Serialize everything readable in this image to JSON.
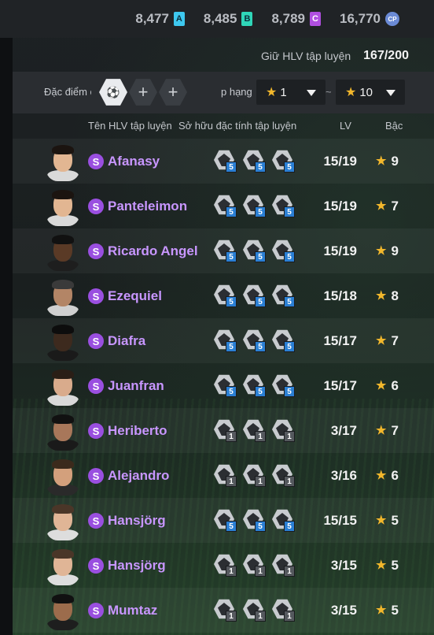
{
  "currency": [
    {
      "value": "8,477",
      "badge": "A",
      "color": "#3ec8ef"
    },
    {
      "value": "8,485",
      "badge": "B",
      "color": "#2fd6b8"
    },
    {
      "value": "8,789",
      "badge": "C",
      "color": "#b04fe0"
    },
    {
      "value": "16,770",
      "badge": "CP",
      "color": "#6b8bd6"
    }
  ],
  "coach_count": {
    "label": "Giữ HLV tập luyện",
    "value": "167/200"
  },
  "filter": {
    "trait_label": "Đặc điểm c",
    "rank_label": "p hạng",
    "min_rank": "1",
    "max_rank": "10",
    "tilde": "~",
    "add_symbol": "+"
  },
  "columns": {
    "name": "Tên HLV tập luyện",
    "traits": "Sở hữu đặc tính tập luyện",
    "lv": "LV",
    "bac": "Bậc"
  },
  "coaches": [
    {
      "grade": "S",
      "name": "Afanasy",
      "lv": "15/19",
      "bac": "9",
      "skin": "#e2b692",
      "hair": "#1b1410",
      "shirt": "#d9d9d9",
      "traits": [
        "5",
        "5",
        "5"
      ]
    },
    {
      "grade": "S",
      "name": "Panteleimon",
      "lv": "15/19",
      "bac": "7",
      "skin": "#e2b692",
      "hair": "#1b1410",
      "shirt": "#d9d9d9",
      "traits": [
        "5",
        "5",
        "5"
      ]
    },
    {
      "grade": "S",
      "name": "Ricardo Angel",
      "lv": "15/19",
      "bac": "9",
      "skin": "#5a3a26",
      "hair": "#111111",
      "shirt": "#1e1e1e",
      "traits": [
        "5",
        "5",
        "5"
      ]
    },
    {
      "grade": "S",
      "name": "Ezequiel",
      "lv": "15/18",
      "bac": "8",
      "skin": "#b38566",
      "hair": "#3a3a3a",
      "shirt": "#d0d0d0",
      "traits": [
        "5",
        "5",
        "5"
      ]
    },
    {
      "grade": "S",
      "name": "Diafra",
      "lv": "15/17",
      "bac": "7",
      "skin": "#3d2a1e",
      "hair": "#0d0d0d",
      "shirt": "#1a1a1a",
      "traits": [
        "5",
        "5",
        "5"
      ]
    },
    {
      "grade": "S",
      "name": "Juanfran",
      "lv": "15/17",
      "bac": "6",
      "skin": "#d9ab8c",
      "hair": "#2a1e16",
      "shirt": "#d9d9d9",
      "traits": [
        "5",
        "5",
        "5"
      ]
    },
    {
      "grade": "S",
      "name": "Heriberto",
      "lv": "3/17",
      "bac": "7",
      "skin": "#a8775a",
      "hair": "#111111",
      "shirt": "#1a1a1a",
      "traits": [
        "1",
        "1",
        "1"
      ]
    },
    {
      "grade": "S",
      "name": "Alejandro",
      "lv": "3/16",
      "bac": "6",
      "skin": "#d3a07c",
      "hair": "#3b2a1c",
      "shirt": "#2a2a2a",
      "traits": [
        "1",
        "1",
        "1"
      ]
    },
    {
      "grade": "S",
      "name": "Hansjörg",
      "lv": "15/15",
      "bac": "5",
      "skin": "#e0b596",
      "hair": "#4a3628",
      "shirt": "#dddddd",
      "traits": [
        "5",
        "5",
        "5"
      ]
    },
    {
      "grade": "S",
      "name": "Hansjörg",
      "lv": "3/15",
      "bac": "5",
      "skin": "#e0b596",
      "hair": "#4a3628",
      "shirt": "#dddddd",
      "traits": [
        "1",
        "1",
        "1"
      ]
    },
    {
      "grade": "S",
      "name": "Mumtaz",
      "lv": "3/15",
      "bac": "5",
      "skin": "#9c6c4c",
      "hair": "#111111",
      "shirt": "#1e1e1e",
      "traits": [
        "1",
        "1",
        "1"
      ]
    }
  ]
}
